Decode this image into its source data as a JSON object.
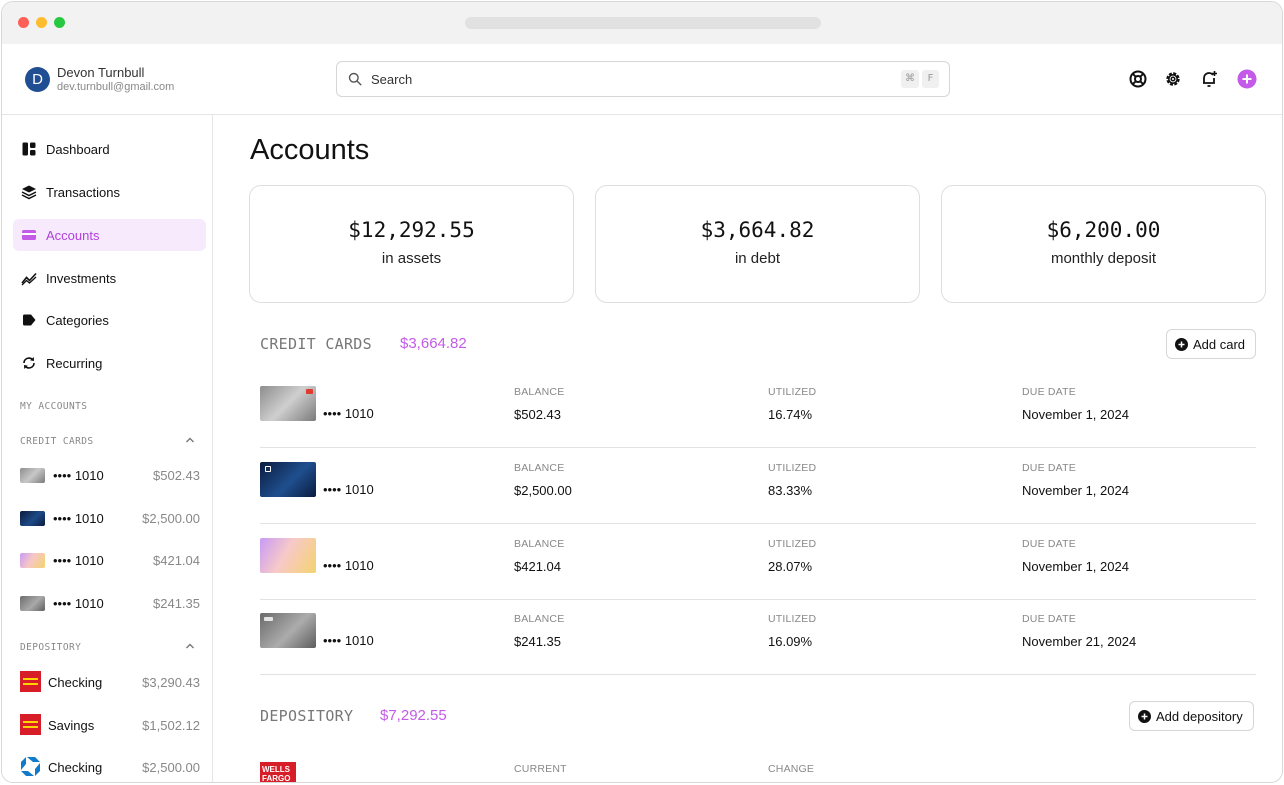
{
  "user": {
    "initial": "D",
    "name": "Devon Turnbull",
    "email": "dev.turnbull@gmail.com"
  },
  "search": {
    "placeholder": "Search",
    "shortcut_keys": [
      "⌘",
      "F"
    ]
  },
  "header_icons": [
    "help-lifebuoy-icon",
    "settings-gear-icon",
    "notification-bell-icon",
    "add-plus-icon"
  ],
  "colors": {
    "accent": "#c35be8",
    "active_bg": "#f6eafc",
    "wells_red": "#d71e28",
    "chase_blue": "#117aca"
  },
  "nav": [
    {
      "label": "Dashboard",
      "icon": "dashboard-icon",
      "active": false
    },
    {
      "label": "Transactions",
      "icon": "layers-icon",
      "active": false
    },
    {
      "label": "Accounts",
      "icon": "credit-card-icon",
      "active": true
    },
    {
      "label": "Investments",
      "icon": "trend-icon",
      "active": false
    },
    {
      "label": "Categories",
      "icon": "tag-icon",
      "active": false
    },
    {
      "label": "Recurring",
      "icon": "refresh-icon",
      "active": false
    }
  ],
  "sidebar": {
    "my_accounts_label": "MY ACCOUNTS",
    "credit_cards_label": "CREDIT CARDS",
    "depository_label": "DEPOSITORY",
    "credit_cards": [
      {
        "name": "•••• 1010",
        "amount": "$502.43"
      },
      {
        "name": "•••• 1010",
        "amount": "$2,500.00"
      },
      {
        "name": "•••• 1010",
        "amount": "$421.04"
      },
      {
        "name": "•••• 1010",
        "amount": "$241.35"
      }
    ],
    "depository": [
      {
        "name": "Checking",
        "amount": "$3,290.43",
        "bank": "wells-fargo-logo-icon"
      },
      {
        "name": "Savings",
        "amount": "$1,502.12",
        "bank": "wells-fargo-logo-icon"
      },
      {
        "name": "Checking",
        "amount": "$2,500.00",
        "bank": "chase-logo-icon"
      }
    ]
  },
  "main": {
    "title": "Accounts",
    "stats": [
      {
        "amount": "$12,292.55",
        "label": "in assets"
      },
      {
        "amount": "$3,664.82",
        "label": "in debt"
      },
      {
        "amount": "$6,200.00",
        "label": "monthly deposit"
      }
    ],
    "credit_cards": {
      "title": "CREDIT CARDS",
      "total": "$3,664.82",
      "add_label": "Add card",
      "col_headers": [
        "BALANCE",
        "UTILIZED",
        "DUE DATE"
      ],
      "rows": [
        {
          "mask": "•••• 1010",
          "balance": "$502.43",
          "utilized": "16.74%",
          "due": "November 1, 2024"
        },
        {
          "mask": "•••• 1010",
          "balance": "$2,500.00",
          "utilized": "83.33%",
          "due": "November 1, 2024"
        },
        {
          "mask": "•••• 1010",
          "balance": "$421.04",
          "utilized": "28.07%",
          "due": "November 1, 2024"
        },
        {
          "mask": "•••• 1010",
          "balance": "$241.35",
          "utilized": "16.09%",
          "due": "November 21, 2024"
        }
      ]
    },
    "depository": {
      "title": "DEPOSITORY",
      "total": "$7,292.55",
      "add_label": "Add depository",
      "col_headers": [
        "CURRENT",
        "CHANGE"
      ],
      "first_row_bank_text": "WELLS FARGO"
    }
  }
}
